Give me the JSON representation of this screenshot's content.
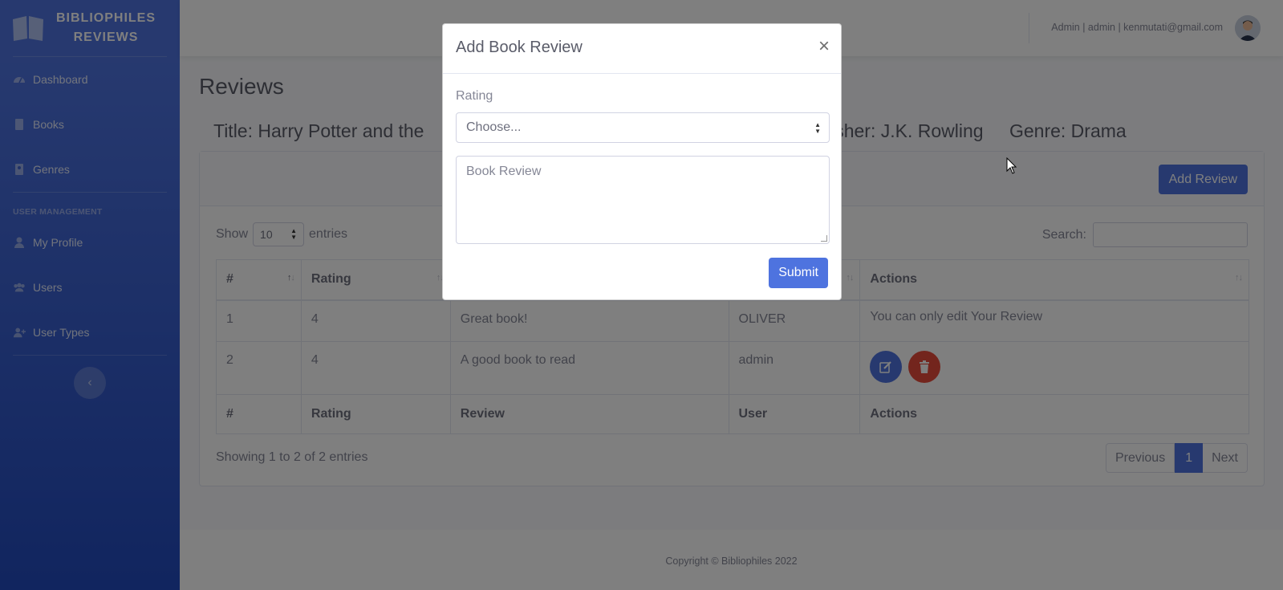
{
  "brand": {
    "line1": "BIBLIOPHILES",
    "line2": "REVIEWS"
  },
  "sidebar": {
    "items": [
      {
        "label": "Dashboard",
        "icon": "tachometer-icon"
      },
      {
        "label": "Books",
        "icon": "book-icon"
      },
      {
        "label": "Genres",
        "icon": "address-book-icon"
      }
    ],
    "heading": "USER MANAGEMENT",
    "user_items": [
      {
        "label": "My Profile",
        "icon": "user-icon"
      },
      {
        "label": "Users",
        "icon": "users-icon"
      },
      {
        "label": "User Types",
        "icon": "user-plus-icon"
      }
    ],
    "toggle_glyph": "‹"
  },
  "topbar": {
    "user_text": "Admin | admin | kenmutati@gmail.com"
  },
  "page": {
    "title": "Reviews",
    "book_title": "Title: Harry Potter and the",
    "publisher": "lisher: J.K. Rowling",
    "genre": "Genre: Drama"
  },
  "card": {
    "add_button": "Add Review",
    "show_label": "Show",
    "entries_value": "10",
    "entries_label": "entries",
    "search_label": "Search:"
  },
  "table": {
    "headers": [
      "#",
      "Rating",
      "Review",
      "User",
      "Actions"
    ],
    "rows": [
      {
        "num": "1",
        "rating": "4",
        "review": "Great book!",
        "user": "OLIVER",
        "actions_text": "You can only edit Your Review"
      },
      {
        "num": "2",
        "rating": "4",
        "review": "A good book to read",
        "user": "admin",
        "actions_text": ""
      }
    ],
    "info": "Showing 1 to 2 of 2 entries",
    "pagination": {
      "previous": "Previous",
      "current": "1",
      "next": "Next"
    }
  },
  "footer": {
    "text": "Copyright © Bibliophiles 2022"
  },
  "modal": {
    "title": "Add Book Review",
    "close_glyph": "×",
    "rating_label": "Rating",
    "rating_selected": "Choose...",
    "review_placeholder": "Book Review",
    "submit_label": "Submit"
  },
  "colors": {
    "primary": "#4e73df",
    "danger": "#e74a3b",
    "sidebar_dark": "#224abe"
  }
}
